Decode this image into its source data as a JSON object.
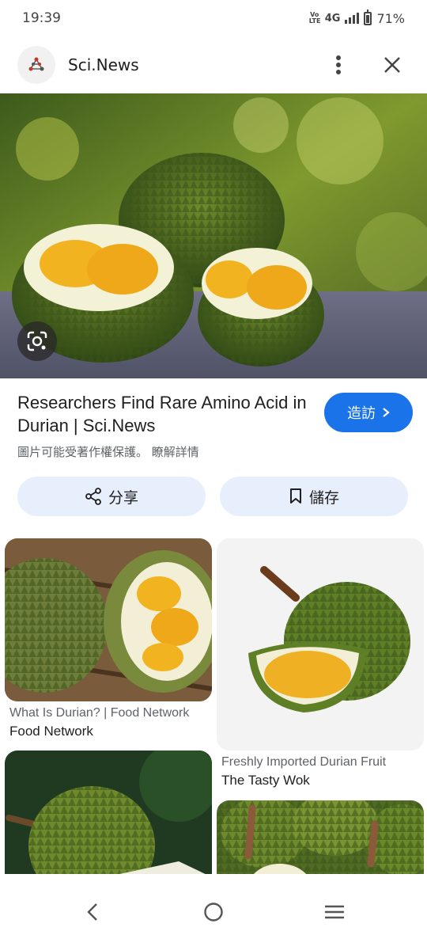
{
  "status_bar": {
    "time": "19:39",
    "volte": "Vo LTE",
    "network": "4G",
    "battery_pct": "71%",
    "battery_level": 0.71
  },
  "header": {
    "site_name": "Sci.News",
    "icons": [
      "site-logo",
      "more-vert-icon",
      "close-icon"
    ]
  },
  "main": {
    "title": "Researchers Find Rare Amino Acid in Durian | Sci.News",
    "copyright_note": "圖片可能受著作權保護。 瞭解詳情",
    "visit_label": "造訪",
    "share_label": "分享",
    "save_label": "儲存"
  },
  "related": [
    {
      "title": "What Is Durian? | Food Network",
      "source": "Food Network"
    },
    {
      "title": "Freshly Imported Durian Fruit",
      "source": "The Tasty Wok"
    },
    {
      "title": "",
      "source": ""
    },
    {
      "title": "",
      "source": ""
    }
  ],
  "colors": {
    "accent": "#1a73e8",
    "chip_bg": "#e8effc"
  }
}
